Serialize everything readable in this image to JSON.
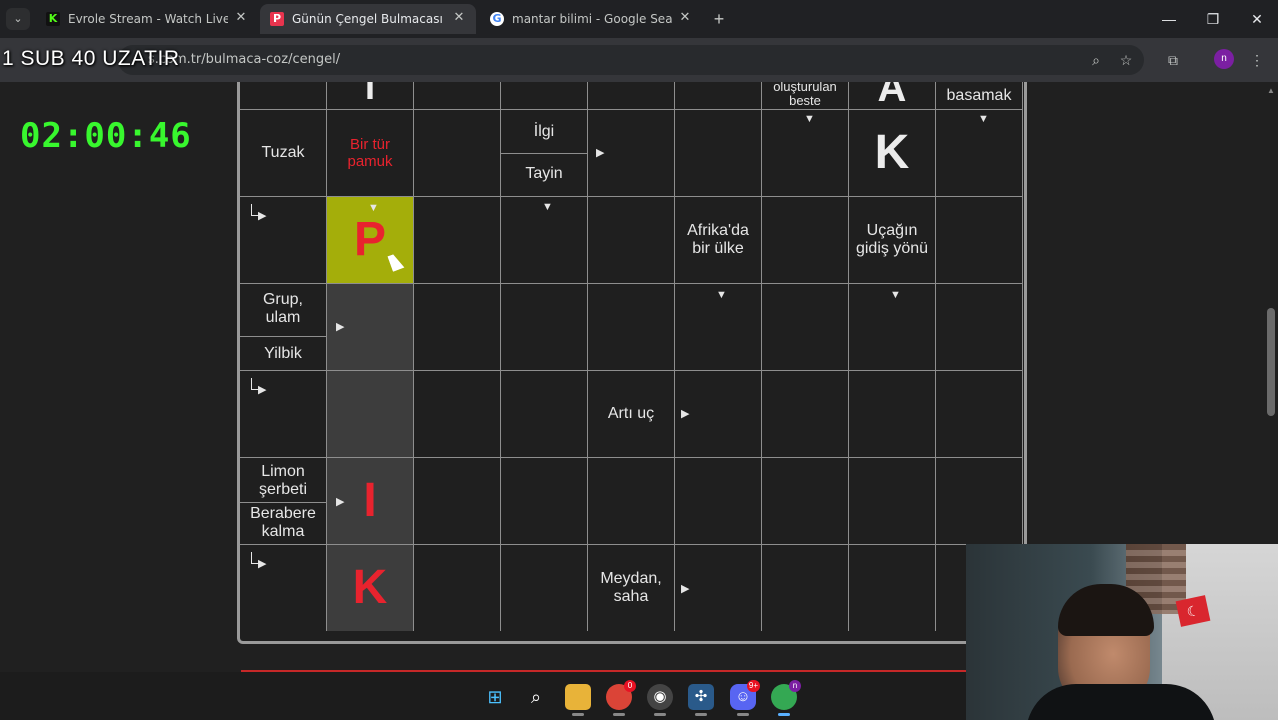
{
  "browser": {
    "tabs": [
      {
        "title": "Evrole Stream - Watch Live on K",
        "favicon": "kick-icon",
        "active": false
      },
      {
        "title": "Günün Çengel Bulmacası - Bug",
        "favicon": "p-icon",
        "active": true
      },
      {
        "title": "mantar bilimi - Google Search",
        "favicon": "google-icon",
        "active": false
      }
    ],
    "url": "s.com.tr/bulmaca-coz/cengel/",
    "profile_initial": "n"
  },
  "overlay": {
    "sub_text": "1 SUB 40 UZATIR",
    "timer": "02:00:46"
  },
  "puzzle": {
    "clues": {
      "top_r0c6": "kalmadan oluşturulan beste",
      "top_r0c8": "basamak",
      "tuzak": "Tuzak",
      "bir_tur_pamuk": "Bir tür pamuk",
      "ilgi": "İlgi",
      "tayin": "Tayin",
      "afrikada": "Afrika'da bir ülke",
      "ucagin": "Uçağın gidiş yönü",
      "grup": "Grup, ulam",
      "yilbik": "Yilbik",
      "arti_uc": "Artı uç",
      "limon": "Limon şerbeti",
      "berabere": "Berabere kalma",
      "meydan": "Meydan, saha"
    },
    "letters": {
      "r0c1": "I",
      "r0c7": "A",
      "r1c7": "K",
      "r2c1": "P",
      "r5c1": "I",
      "r6c1": "K"
    }
  },
  "taskbar": {
    "items": [
      {
        "name": "windows-start-icon"
      },
      {
        "name": "search-icon"
      },
      {
        "name": "file-explorer-icon"
      },
      {
        "name": "chrome-icon",
        "badge": "0"
      },
      {
        "name": "obs-icon"
      },
      {
        "name": "app-icon"
      },
      {
        "name": "discord-icon",
        "badge": "9+"
      },
      {
        "name": "chrome-profile-icon",
        "badge": "n"
      }
    ]
  },
  "colors": {
    "timer": "#38f72e",
    "highlight_cell": "#a4ae0a",
    "red_text": "#e8232e",
    "filled_cell": "#3d3d3d"
  }
}
